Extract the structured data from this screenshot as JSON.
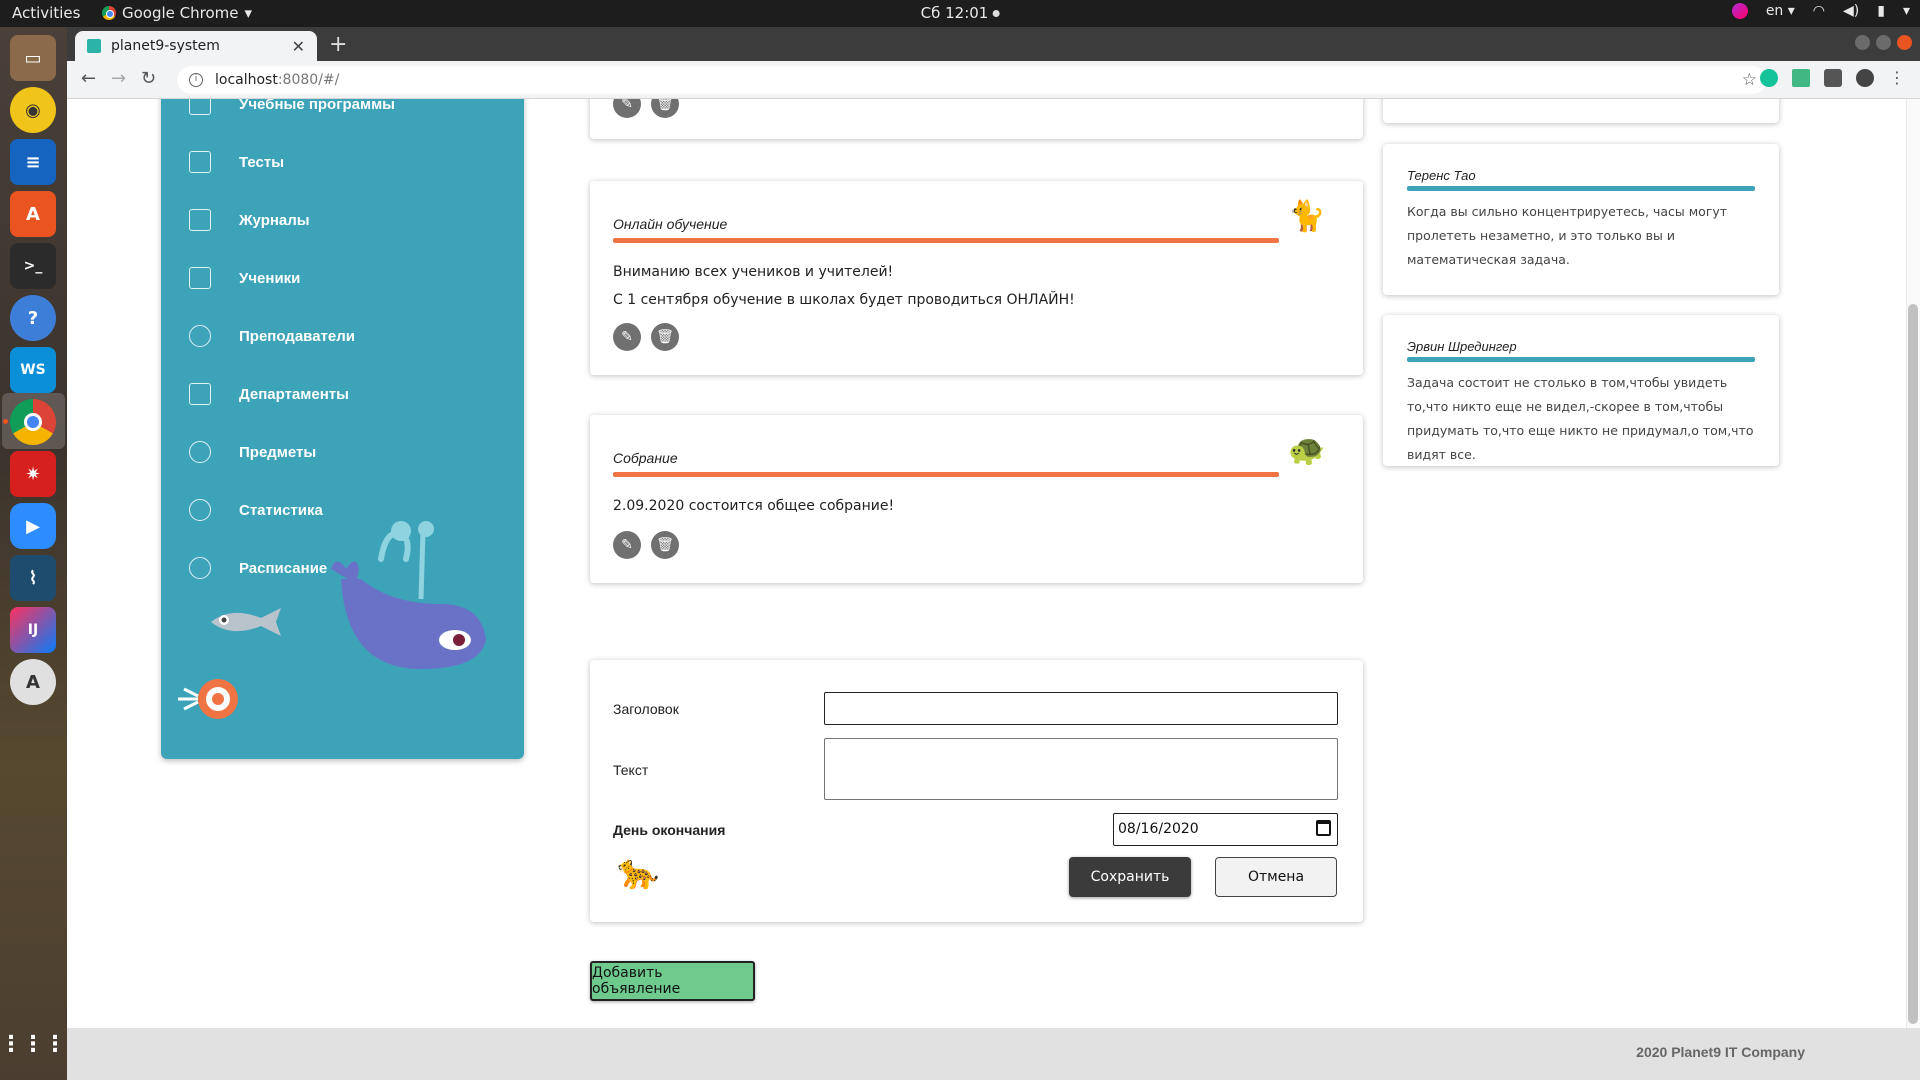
{
  "system": {
    "activities": "Activities",
    "app_name": "Google Chrome",
    "clock": "Сб 12:01",
    "lang": "en"
  },
  "browser": {
    "tab_title": "planet9-system",
    "url_host": "localhost",
    "url_path": ":8080/#/"
  },
  "sidebar": {
    "items": [
      {
        "label": "Учебные программы",
        "icon": "curriculum-icon"
      },
      {
        "label": "Тесты",
        "icon": "tests-icon"
      },
      {
        "label": "Журналы",
        "icon": "journals-icon"
      },
      {
        "label": "Ученики",
        "icon": "students-icon"
      },
      {
        "label": "Преподаватели",
        "icon": "teachers-icon"
      },
      {
        "label": "Департаменты",
        "icon": "departments-icon"
      },
      {
        "label": "Предметы",
        "icon": "subjects-icon"
      },
      {
        "label": "Статистика",
        "icon": "statistics-icon"
      },
      {
        "label": "Расписание",
        "icon": "schedule-icon"
      }
    ]
  },
  "announcements": [
    {
      "title": "Онлайн обучение",
      "lines": [
        "Вниманию всех учеников и учителей!",
        "С 1 сентября обучение в школах будет проводиться ОНЛАЙН!"
      ],
      "animal": "cat-icon"
    },
    {
      "title": "Собрание",
      "lines": [
        "2.09.2020 состоится общее собрание!"
      ],
      "animal": "turtle-icon"
    }
  ],
  "quotes": [
    {
      "author": "Теренс Тао",
      "text": "Когда вы сильно концентрируетесь, часы могут пролететь незаметно, и это только вы и математическая задача."
    },
    {
      "author": "Эрвин Шредингер",
      "text": "Задача состоит не столько в том,чтобы увидеть то,что никто еще не видел,-скорее в том,чтобы придумать то,что еще никто не придумал,о том,что видят все."
    }
  ],
  "form": {
    "title_label": "Заголовок",
    "title_value": "",
    "text_label": "Текст",
    "text_value": "",
    "end_date_label": "День окончания",
    "end_date_value": "08/16/2020",
    "save_label": "Сохранить",
    "cancel_label": "Отмена"
  },
  "add_button_label": "Добавить объявление",
  "footer": "2020 Planet9 IT Company",
  "colors": {
    "sidebar": "#3ca3b9",
    "accent_orange": "#f07443",
    "accent_teal": "#3ca3b9",
    "add_button": "#6fca8e"
  }
}
